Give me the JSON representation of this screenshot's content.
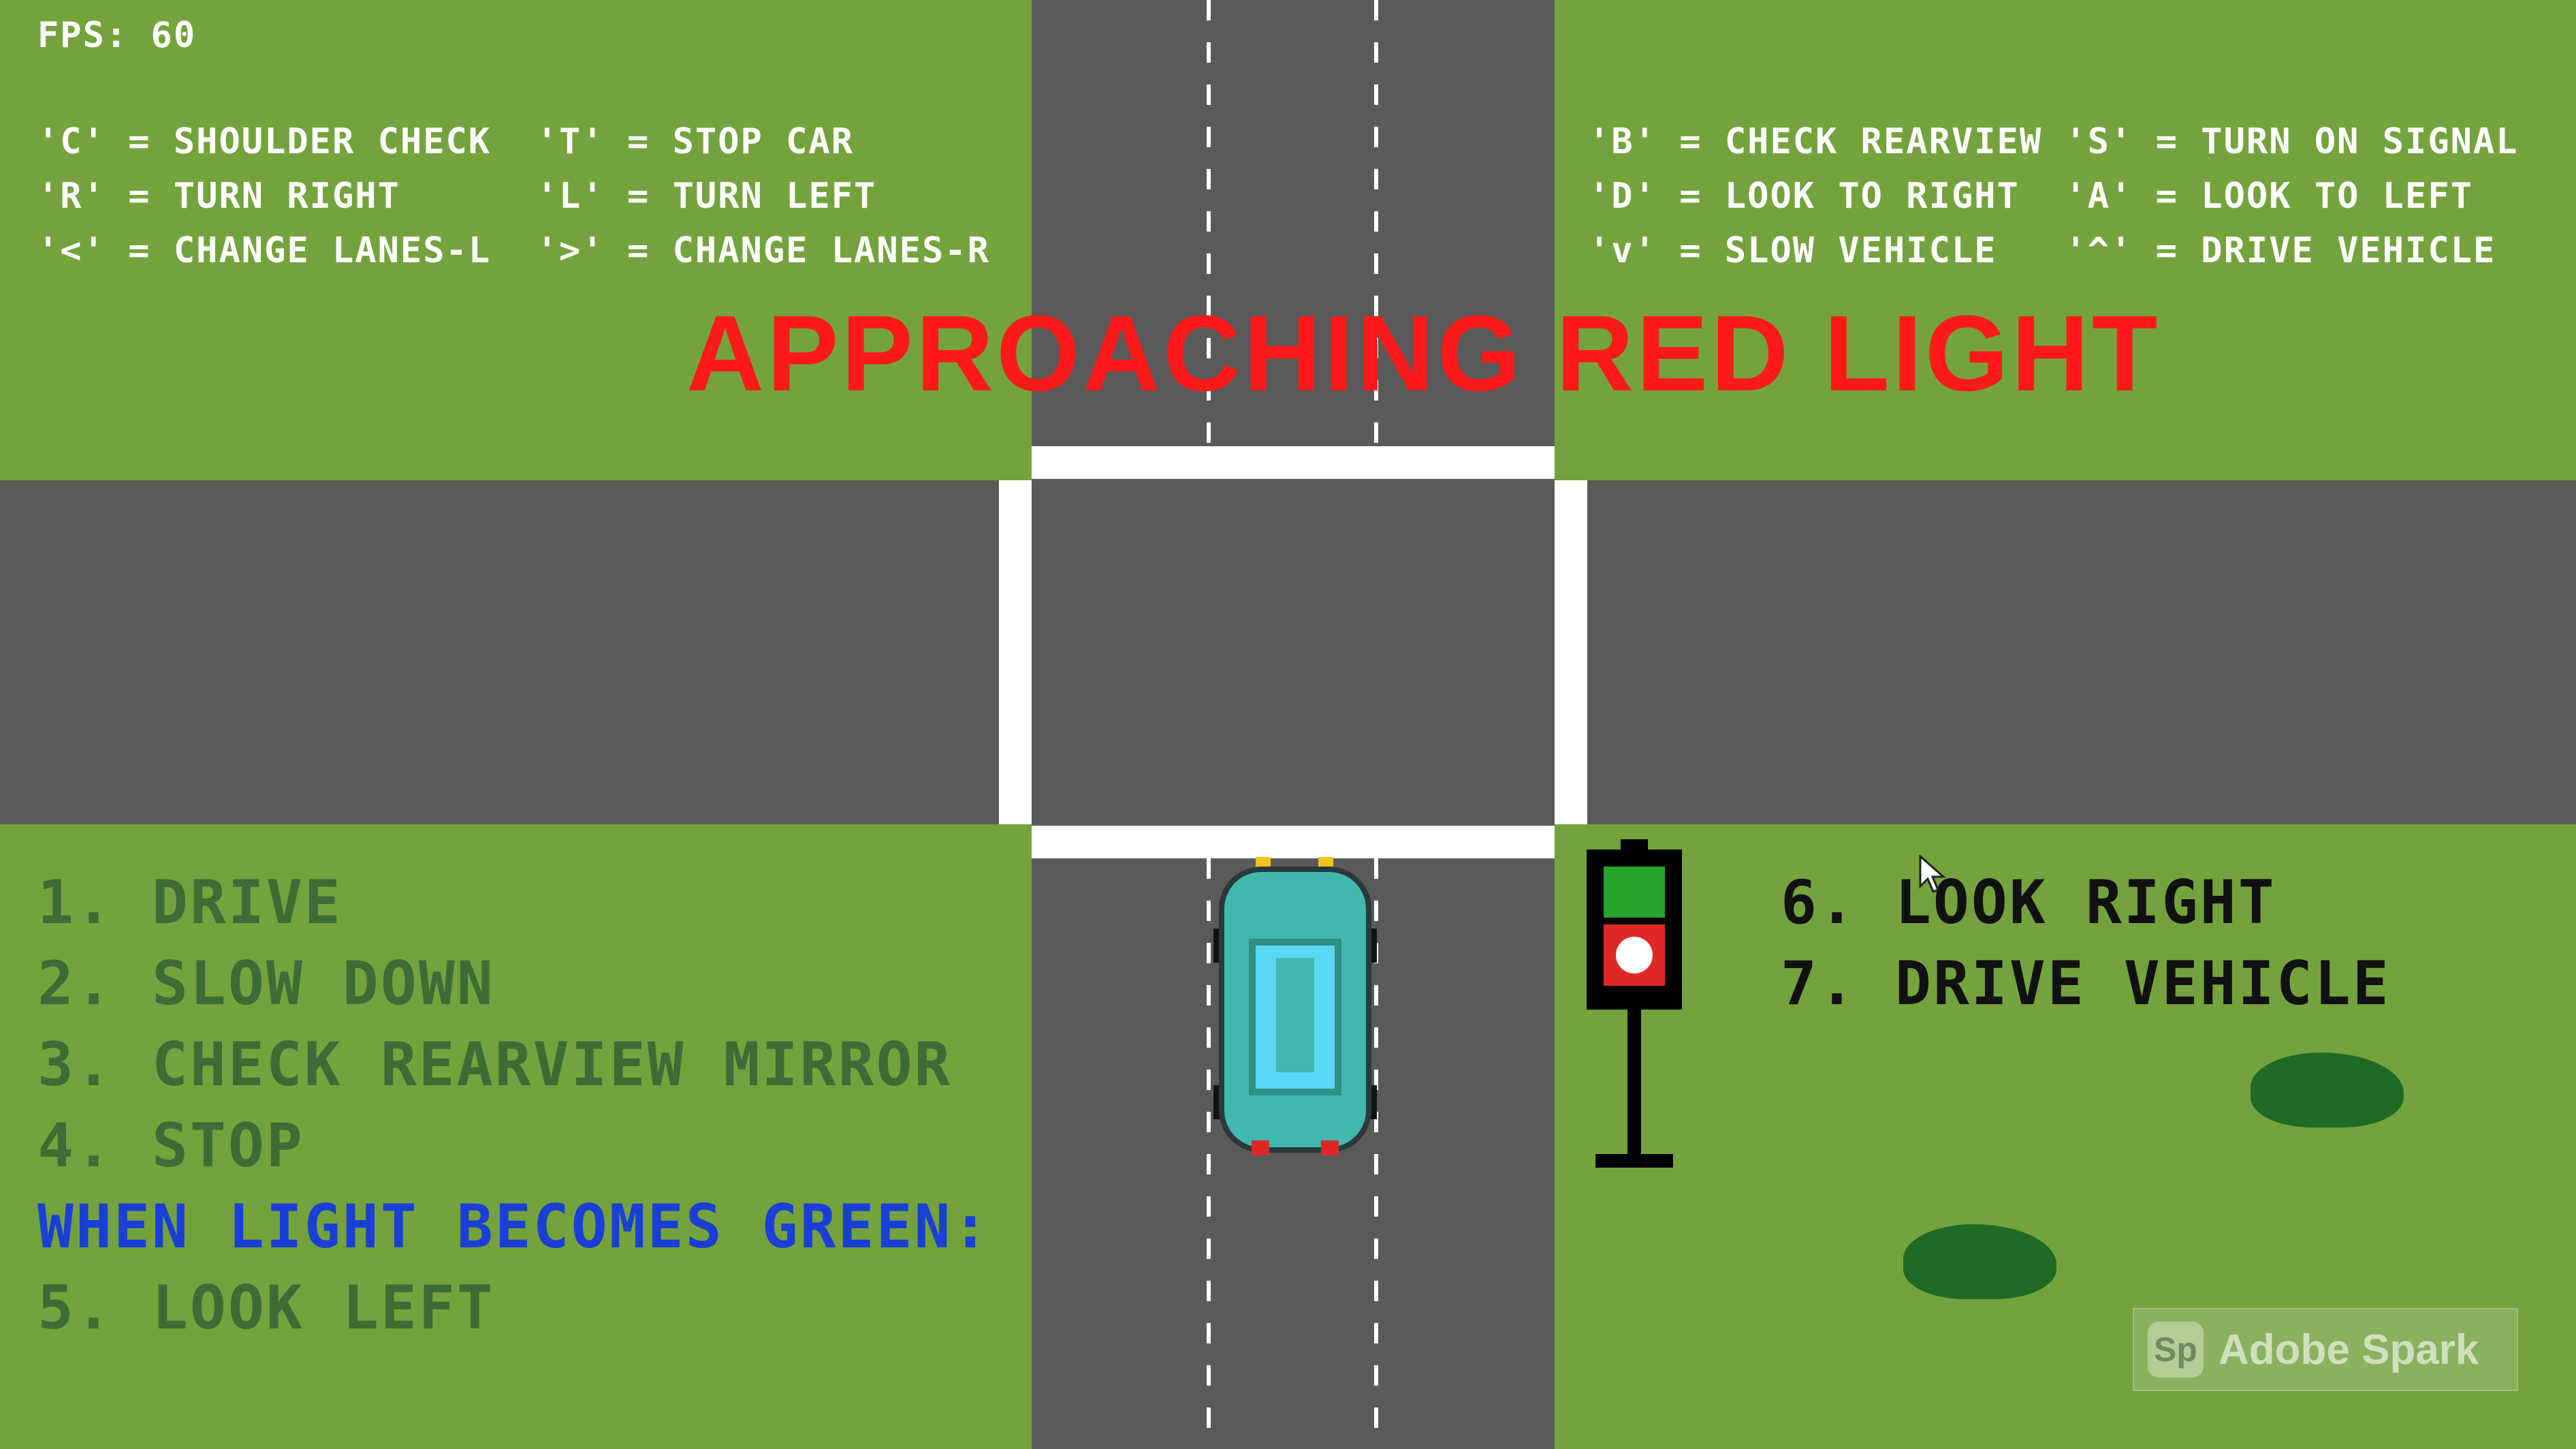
{
  "hud": {
    "fps": "FPS: 60",
    "controls_left": [
      "'C' = SHOULDER CHECK  'T' = STOP CAR",
      "'R' = TURN RIGHT      'L' = TURN LEFT",
      "'<' = CHANGE LANES-L  '>' = CHANGE LANES-R"
    ],
    "controls_right": [
      "'B' = CHECK REARVIEW 'S' = TURN ON SIGNAL",
      "'D' = LOOK TO RIGHT  'A' = LOOK TO LEFT",
      "'v' = SLOW VEHICLE   '^' = DRIVE VEHICLE"
    ]
  },
  "banner": {
    "text": "APPROACHING RED LIGHT",
    "color": "#ff1a1a"
  },
  "steps_left": [
    "1. DRIVE",
    "2. SLOW DOWN",
    "3. CHECK REARVIEW MIRROR",
    "4. STOP"
  ],
  "when_label": "WHEN LIGHT BECOMES GREEN:",
  "step_5": "5. LOOK LEFT",
  "steps_right": [
    "6. LOOK RIGHT",
    "7. DRIVE VEHICLE"
  ],
  "traffic_light": {
    "top_lamp": "green",
    "bottom_lamp": "red"
  },
  "watermark": {
    "icon": "Sp",
    "text": "Adobe Spark"
  },
  "colors": {
    "grass": "#74a33d",
    "road": "#5a5a5a",
    "done_step": "#3f6b36",
    "active_step": "#111111",
    "when_label": "#1a3fd6",
    "car_body": "#41b8ae",
    "car_window": "#59d7f5"
  }
}
